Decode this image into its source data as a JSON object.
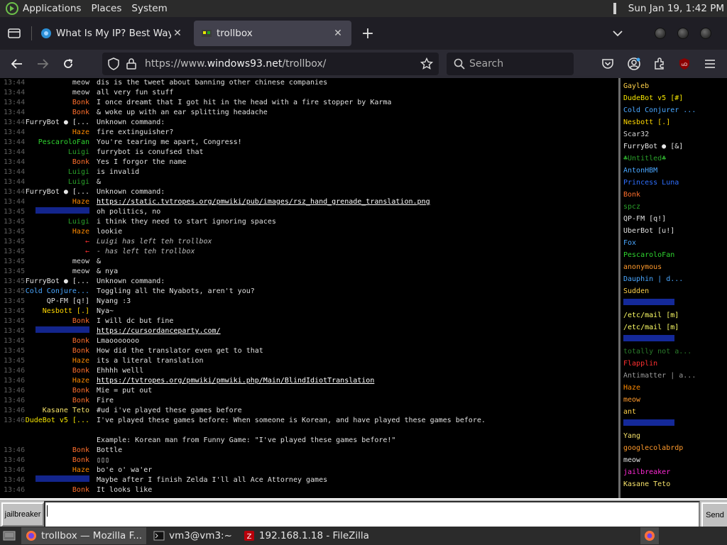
{
  "panel": {
    "menus": [
      "Applications",
      "Places",
      "System"
    ],
    "clock": "Sun Jan 19,  1:42 PM"
  },
  "tabs": [
    {
      "title": "What Is My IP? Best Way To",
      "active": false
    },
    {
      "title": "trollbox",
      "active": true
    }
  ],
  "navbar": {
    "url_prefix": "https://www.",
    "url_domain": "windows93.net",
    "url_path": "/trollbox/",
    "search_placeholder": "Search"
  },
  "colors": {
    "time": "#5f5f5f",
    "meow": "#d8d8d8",
    "bonk": "#ff6f2c",
    "haze": "#ff8a00",
    "luigi": "#2aa02a",
    "furrybot": "#e6e6e6",
    "pescarolofan": "#2fd52f",
    "hidden_blue": "#2244ff",
    "coldconjurer": "#4aa7ff",
    "qpfm": "#e0e0e0",
    "nesbott": "#ffd700",
    "kasane": "#f6e26a",
    "dudebot": "#f6e600",
    "red": "#ff3030"
  },
  "chat": [
    {
      "time": "13:44",
      "nick": "meow",
      "color": "meow",
      "msg": "dis is the tweet about banning other chinese companies"
    },
    {
      "time": "13:44",
      "nick": "meow",
      "color": "meow",
      "msg": "all very fun stuff"
    },
    {
      "time": "13:44",
      "nick": "Bonk",
      "color": "bonk",
      "msg": "I once dreamt that I got hit in the head with a fire stopper by Karma"
    },
    {
      "time": "13:44",
      "nick": "Bonk",
      "color": "bonk",
      "msg": "& woke up with an ear splitting headache"
    },
    {
      "time": "13:44",
      "nick": "FurryBot ● [...",
      "color": "furrybot",
      "msg": "Unknown command:"
    },
    {
      "time": "13:44",
      "nick": "Haze",
      "color": "haze",
      "msg": "fire extinguisher?"
    },
    {
      "time": "13:44",
      "nick": "PescaroloFan",
      "color": "pescarolofan",
      "msg": "You're tearing me apart, Congress!"
    },
    {
      "time": "13:44",
      "nick": "Luigi",
      "color": "luigi",
      "msg": "furrybot is conufsed that"
    },
    {
      "time": "13:44",
      "nick": "Bonk",
      "color": "bonk",
      "msg": "Yes I forgor the name"
    },
    {
      "time": "13:44",
      "nick": "Luigi",
      "color": "luigi",
      "msg": "is invalid"
    },
    {
      "time": "13:44",
      "nick": "Luigi",
      "color": "luigi",
      "msg": "&"
    },
    {
      "time": "13:44",
      "nick": "FurryBot ● [...",
      "color": "furrybot",
      "msg": "Unknown command:"
    },
    {
      "time": "13:44",
      "nick": "Haze",
      "color": "haze",
      "msg": "https://static.tvtropes.org/pmwiki/pub/images/rsz_hand_grenade_translation.png",
      "type": "link"
    },
    {
      "time": "13:45",
      "nick": "",
      "color": "hidden_blue",
      "msg": "oh politics, no"
    },
    {
      "time": "13:45",
      "nick": "Luigi",
      "color": "luigi",
      "msg": "i think they need to start ignoring spaces"
    },
    {
      "time": "13:45",
      "nick": "Haze",
      "color": "haze",
      "msg": "lookie"
    },
    {
      "time": "13:45",
      "nick": "←",
      "color": "red",
      "msg": "Luigi has left teh trollbox",
      "type": "sys"
    },
    {
      "time": "13:45",
      "nick": "←",
      "color": "red",
      "msg": "- has left teh trollbox",
      "type": "sys"
    },
    {
      "time": "13:45",
      "nick": "meow",
      "color": "meow",
      "msg": "&"
    },
    {
      "time": "13:45",
      "nick": "meow",
      "color": "meow",
      "msg": "& nya"
    },
    {
      "time": "13:45",
      "nick": "FurryBot ● [...",
      "color": "furrybot",
      "msg": "Unknown command:"
    },
    {
      "time": "13:45",
      "nick": "Cold Conjure...",
      "color": "coldconjurer",
      "msg": "Toggling all the Nyabots, aren't you?"
    },
    {
      "time": "13:45",
      "nick": "QP-FM [q!]",
      "color": "qpfm",
      "msg": "Nyang :3"
    },
    {
      "time": "13:45",
      "nick": "Nesbott [.]",
      "color": "nesbott",
      "msg": "Nya~"
    },
    {
      "time": "13:45",
      "nick": "Bonk",
      "color": "bonk",
      "msg": "I will dc but fine"
    },
    {
      "time": "13:45",
      "nick": "",
      "color": "hidden_blue",
      "msg": "https://cursordanceparty.com/",
      "type": "link"
    },
    {
      "time": "13:45",
      "nick": "Bonk",
      "color": "bonk",
      "msg": "Lmaooooooo"
    },
    {
      "time": "13:45",
      "nick": "Bonk",
      "color": "bonk",
      "msg": "How did the translator even get to that"
    },
    {
      "time": "13:45",
      "nick": "Haze",
      "color": "haze",
      "msg": "its a literal translation"
    },
    {
      "time": "13:46",
      "nick": "Bonk",
      "color": "bonk",
      "msg": "Ehhhh welll"
    },
    {
      "time": "13:46",
      "nick": "Haze",
      "color": "haze",
      "msg": "https://tvtropes.org/pmwiki/pmwiki.php/Main/BlindIdiotTranslation",
      "type": "link"
    },
    {
      "time": "13:46",
      "nick": "Bonk",
      "color": "bonk",
      "msg": "Mie = put out"
    },
    {
      "time": "13:46",
      "nick": "Bonk",
      "color": "bonk",
      "msg": "Fire"
    },
    {
      "time": "13:46",
      "nick": "Kasane Teto",
      "color": "kasane",
      "msg": "#ud i've played these games before"
    },
    {
      "time": "13:46",
      "nick": "DudeBot v5 [...",
      "color": "dudebot",
      "msg": "I've played these games before: When someone is Korean, and have played these games before."
    },
    {
      "time": "",
      "nick": "",
      "color": "meow",
      "msg": ""
    },
    {
      "time": "",
      "nick": "",
      "color": "meow",
      "msg": "Example: Korean man from Funny Game: \"I've played these games before!\""
    },
    {
      "time": "13:46",
      "nick": "Bonk",
      "color": "bonk",
      "msg": "Bottle"
    },
    {
      "time": "13:46",
      "nick": "Bonk",
      "color": "bonk",
      "msg": "▯▯▯"
    },
    {
      "time": "13:46",
      "nick": "Haze",
      "color": "haze",
      "msg": "bo'e o' wa'er"
    },
    {
      "time": "13:46",
      "nick": "",
      "color": "hidden_blue",
      "msg": "Maybe after I finish Zelda I'll all Ace Attorney games"
    },
    {
      "time": "13:46",
      "nick": "Bonk",
      "color": "bonk",
      "msg": "It looks like"
    }
  ],
  "users": [
    {
      "name": "Gayleb",
      "color": "#ffd24a"
    },
    {
      "name": "DudeBot v5 [#]",
      "color": "#f6e600"
    },
    {
      "name": "Cold Conjurer ...",
      "color": "#4aa7ff"
    },
    {
      "name": "Nesbott [.]",
      "color": "#ffd700"
    },
    {
      "name": "Scar32",
      "color": "#d8d8d8"
    },
    {
      "name": "FurryBot ● [&]",
      "color": "#e6e6e6"
    },
    {
      "name": "♣Untitled♣",
      "color": "#2aa02a"
    },
    {
      "name": "AntonHBM",
      "color": "#4aa7ff"
    },
    {
      "name": "Princess Luna",
      "color": "#2f6fff"
    },
    {
      "name": "Bonk",
      "color": "#ff6f2c"
    },
    {
      "name": "spcz",
      "color": "#2aa02a"
    },
    {
      "name": "QP-FM [q!]",
      "color": "#e0e0e0"
    },
    {
      "name": "UberBot [u!]",
      "color": "#e0e0e0"
    },
    {
      "name": "Fox",
      "color": "#4aa7ff"
    },
    {
      "name": "PescaroloFan",
      "color": "#2fd52f"
    },
    {
      "name": "anonymous",
      "color": "#ff9a2c"
    },
    {
      "name": "Dauphin | d...",
      "color": "#4aa7ff"
    },
    {
      "name": "Sudden",
      "color": "#ffd24a"
    },
    {
      "name": "",
      "color": "#2244ff"
    },
    {
      "name": "/etc/mail [m]",
      "color": "#ffff66"
    },
    {
      "name": "/etc/mail [m]",
      "color": "#ffff66"
    },
    {
      "name": "",
      "color": "#2244ff"
    },
    {
      "name": "totally not a...",
      "color": "#2a7a2a"
    },
    {
      "name": "Flapplin",
      "color": "#ff3030"
    },
    {
      "name": "Antimatter | a...",
      "color": "#9a9a9a"
    },
    {
      "name": "Haze",
      "color": "#ff8a00"
    },
    {
      "name": "meow",
      "color": "#ff9a2c"
    },
    {
      "name": "ant",
      "color": "#ffd24a"
    },
    {
      "name": "",
      "color": "#2244ff"
    },
    {
      "name": "Yang",
      "color": "#f6e26a"
    },
    {
      "name": "googlecolabrdp",
      "color": "#ff9a2c"
    },
    {
      "name": "meow",
      "color": "#e0e0e0"
    },
    {
      "name": "jailbreaker",
      "color": "#ff2ad5"
    },
    {
      "name": "Kasane Teto",
      "color": "#f6e26a"
    }
  ],
  "input": {
    "nick_button": "jailbreaker",
    "value": "",
    "send_label": "Send"
  },
  "taskbar": [
    {
      "label": "trollbox — Mozilla F...",
      "active": true
    },
    {
      "label": "vm3@vm3:~",
      "active": false
    },
    {
      "label": "192.168.1.18 - FileZilla",
      "active": false
    }
  ]
}
